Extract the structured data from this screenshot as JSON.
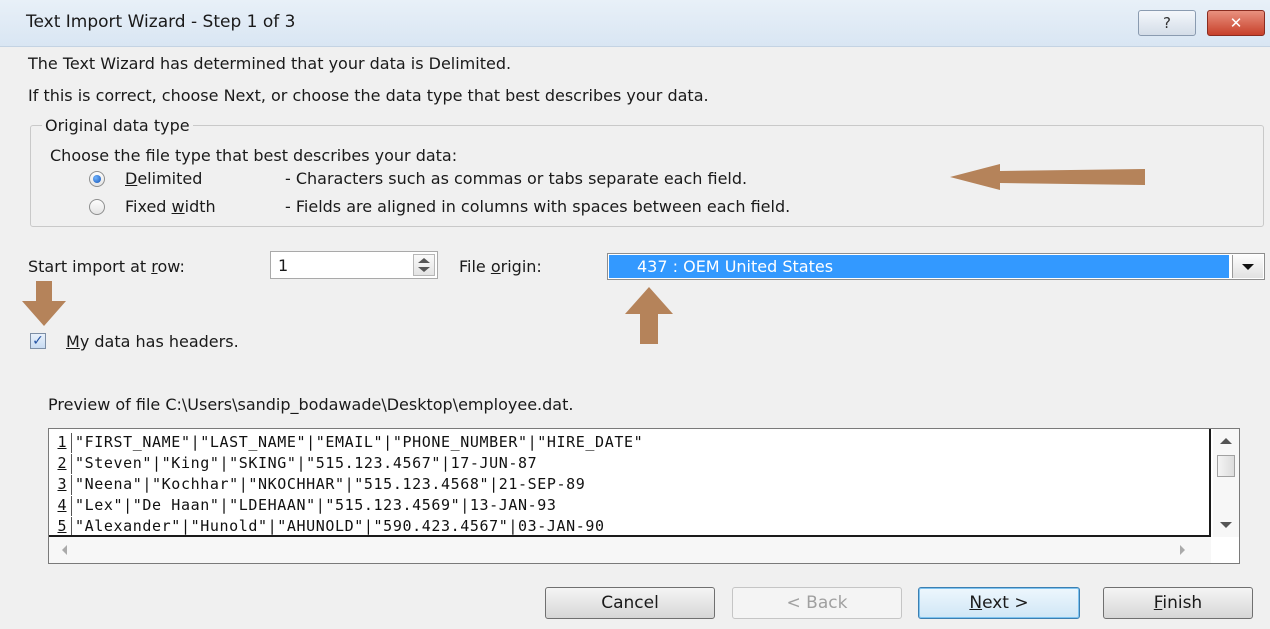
{
  "window": {
    "title": "Text Import Wizard - Step 1 of 3",
    "help_glyph": "?",
    "close_glyph": "✕"
  },
  "intro": {
    "line1": "The Text Wizard has determined that your data is Delimited.",
    "line2": "If this is correct, choose Next, or choose the data type that best describes your data."
  },
  "data_type_group": {
    "title": "Original data type",
    "prompt": "Choose the file type that best describes your data:",
    "options": [
      {
        "label_pre": "",
        "label_key": "D",
        "label_post": "elimited",
        "description": "- Characters such as commas or tabs separate each field.",
        "selected": true
      },
      {
        "label_pre": "Fixed ",
        "label_key": "w",
        "label_post": "idth",
        "description": "- Fields are aligned in columns with spaces between each field.",
        "selected": false
      }
    ]
  },
  "start_row": {
    "label_pre": "Start import at ",
    "label_key": "r",
    "label_post": "ow:",
    "value": "1"
  },
  "file_origin": {
    "label_pre": "File ",
    "label_key": "o",
    "label_post": "rigin:",
    "value": "437 : OEM United States"
  },
  "headers_checkbox": {
    "label_key": "M",
    "label_post": "y data has headers.",
    "checked": true
  },
  "preview": {
    "label": "Preview of file C:\\Users\\sandip_bodawade\\Desktop\\employee.dat.",
    "rows": [
      {
        "num": "1",
        "text": "\"FIRST_NAME\"|\"LAST_NAME\"|\"EMAIL\"|\"PHONE_NUMBER\"|\"HIRE_DATE\""
      },
      {
        "num": "2",
        "text": "\"Steven\"|\"King\"|\"SKING\"|\"515.123.4567\"|17-JUN-87"
      },
      {
        "num": "3",
        "text": "\"Neena\"|\"Kochhar\"|\"NKOCHHAR\"|\"515.123.4568\"|21-SEP-89"
      },
      {
        "num": "4",
        "text": "\"Lex\"|\"De Haan\"|\"LDEHAAN\"|\"515.123.4569\"|13-JAN-93"
      },
      {
        "num": "5",
        "text": "\"Alexander\"|\"Hunold\"|\"AHUNOLD\"|\"590.423.4567\"|03-JAN-90"
      }
    ]
  },
  "buttons": {
    "cancel": "Cancel",
    "back": "< Back",
    "next_key": "N",
    "next_post": "ext >",
    "finish_key": "F",
    "finish_post": "inish"
  },
  "colors": {
    "annotation_arrow": "#b5835a",
    "selection": "#3399ff"
  }
}
